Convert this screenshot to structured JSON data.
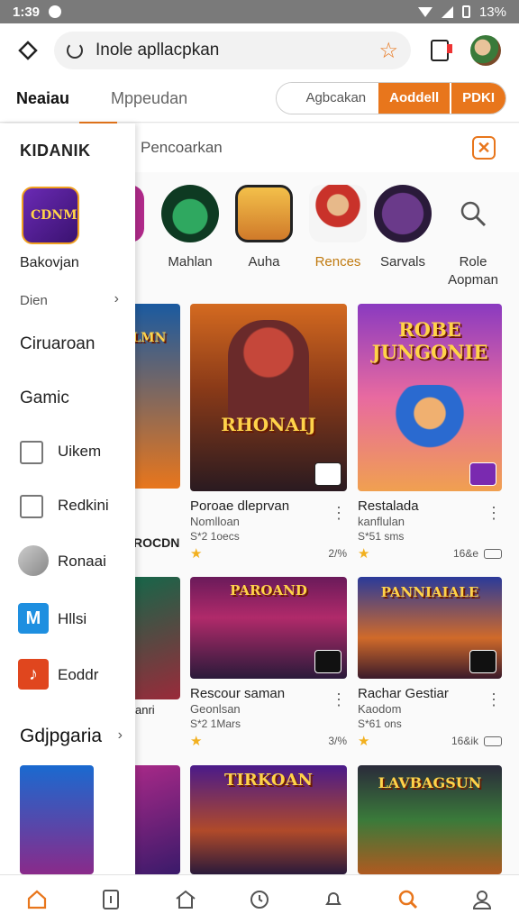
{
  "status_bar": {
    "time": "1:39",
    "battery": "13%"
  },
  "address_bar": {
    "url": "Inole apllacpkan"
  },
  "top_tabs": {
    "active": "Neaiau",
    "secondary": "Mppeudan",
    "group": [
      "Agbcakan",
      "Aoddell",
      "PDKI"
    ]
  },
  "search": {
    "placeholder": "Pencoarkan"
  },
  "categories": [
    {
      "label": "Mahlan"
    },
    {
      "label": "Auha"
    },
    {
      "label": "Rences"
    },
    {
      "label": "Sarvals"
    },
    {
      "label": "Role Aopman"
    }
  ],
  "drawer": {
    "title": "KIDANIK",
    "app_label": "Bakovjan",
    "app_icon_text": "CDNM",
    "section_label": "Dien",
    "items_text": [
      "Ciruaroan",
      "Gamic"
    ],
    "items_icon": [
      {
        "label": "Uikem",
        "icon": "grid-icon"
      },
      {
        "label": "Redkini",
        "icon": "box-icon"
      },
      {
        "label": "Ronaai",
        "icon": "bolt-icon"
      },
      {
        "label": "Hllsi",
        "icon": "m-logo-icon"
      },
      {
        "label": "Eoddr",
        "icon": "music-icon"
      }
    ],
    "bottom_label": "Gdjpgaria"
  },
  "cards": [
    {
      "name": "Poroae dleprvan",
      "sub": "Nomlloan",
      "meta_left": "S*2 1oecs",
      "meta_right": "2/%",
      "art": "RHONAIJ"
    },
    {
      "name": "Restalada",
      "sub": "kanflulan",
      "meta_left": "S*51 sms",
      "meta_right": "16&e",
      "art": "ROBE JUNGONIE"
    },
    {
      "name": "Rescour saman",
      "sub": "Geonlsan",
      "meta_left": "S*2 1Mars",
      "meta_right": "3/%",
      "art": "PAROAND"
    },
    {
      "name": "Rachar Gestiar",
      "sub": "Kaodom",
      "meta_left": "S*61 ons",
      "meta_right": "16&ik",
      "art": "PANNIAIALE"
    },
    {
      "name": "",
      "sub": "",
      "meta_left": "",
      "meta_right": "",
      "art": "TIRKOAN"
    },
    {
      "name": "",
      "sub": "",
      "meta_left": "",
      "meta_right": "",
      "art": "LAVBAGSUN"
    }
  ],
  "left_partial": {
    "text1": "ROCDN",
    "text2": "anri",
    "art": "NLMN"
  }
}
